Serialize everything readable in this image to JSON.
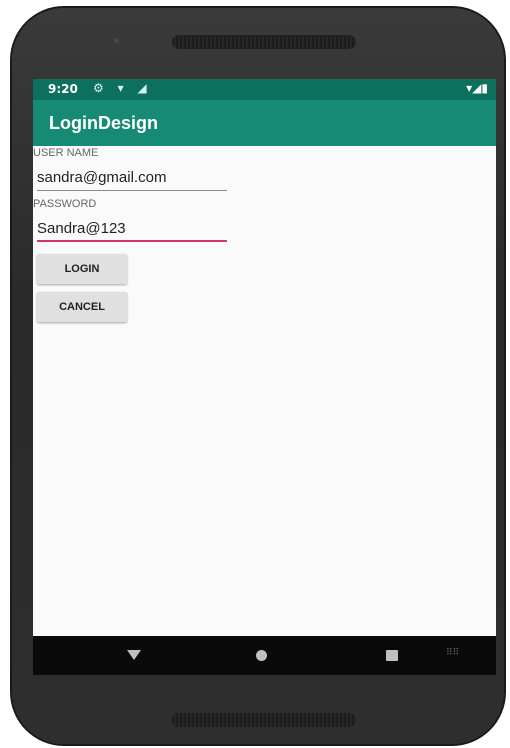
{
  "status_bar": {
    "time": "9:20",
    "left_icons": "⚙ ▾ ◢",
    "right_icons": "▾◢▮"
  },
  "app_bar": {
    "title": "LoginDesign"
  },
  "form": {
    "username_label": "USER NAME",
    "username_value": "sandra@gmail.com",
    "password_label": "PASSWORD",
    "password_value": "Sandra@123"
  },
  "buttons": {
    "login": "LOGIN",
    "cancel": "CANCEL"
  },
  "nav_bar": {
    "keyboard_glyph": "⠿⠿"
  },
  "colors": {
    "status_bar": "#0d6f5e",
    "app_bar": "#178a76",
    "accent": "#d0356e"
  }
}
